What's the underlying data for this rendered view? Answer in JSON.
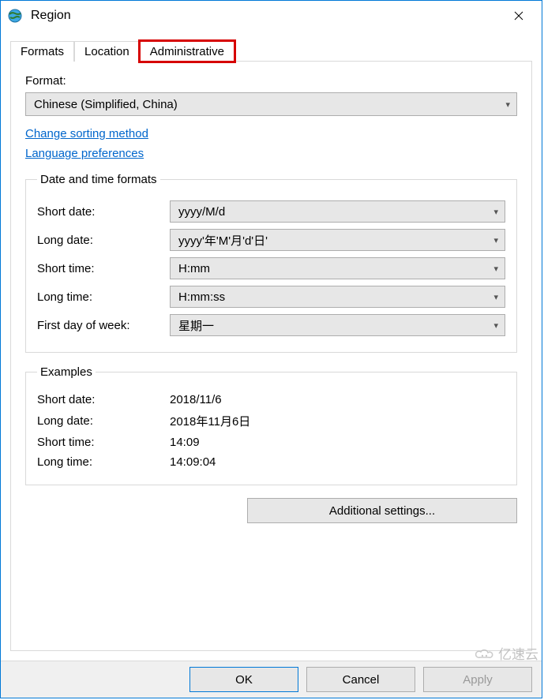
{
  "window": {
    "title": "Region"
  },
  "tabs": {
    "formats": "Formats",
    "location": "Location",
    "administrative": "Administrative"
  },
  "format": {
    "label": "Format:",
    "selected": "Chinese (Simplified, China)"
  },
  "links": {
    "sorting": "Change sorting method",
    "language": "Language preferences"
  },
  "datetime": {
    "legend": "Date and time formats",
    "short_date_label": "Short date:",
    "short_date_value": "yyyy/M/d",
    "long_date_label": "Long date:",
    "long_date_value": "yyyy'年'M'月'd'日'",
    "short_time_label": "Short time:",
    "short_time_value": "H:mm",
    "long_time_label": "Long time:",
    "long_time_value": "H:mm:ss",
    "first_day_label": "First day of week:",
    "first_day_value": "星期一"
  },
  "examples": {
    "legend": "Examples",
    "short_date_label": "Short date:",
    "short_date_value": "2018/11/6",
    "long_date_label": "Long date:",
    "long_date_value": "2018年11月6日",
    "short_time_label": "Short time:",
    "short_time_value": "14:09",
    "long_time_label": "Long time:",
    "long_time_value": "14:09:04"
  },
  "buttons": {
    "additional": "Additional settings...",
    "ok": "OK",
    "cancel": "Cancel",
    "apply": "Apply"
  },
  "watermark": "亿速云"
}
